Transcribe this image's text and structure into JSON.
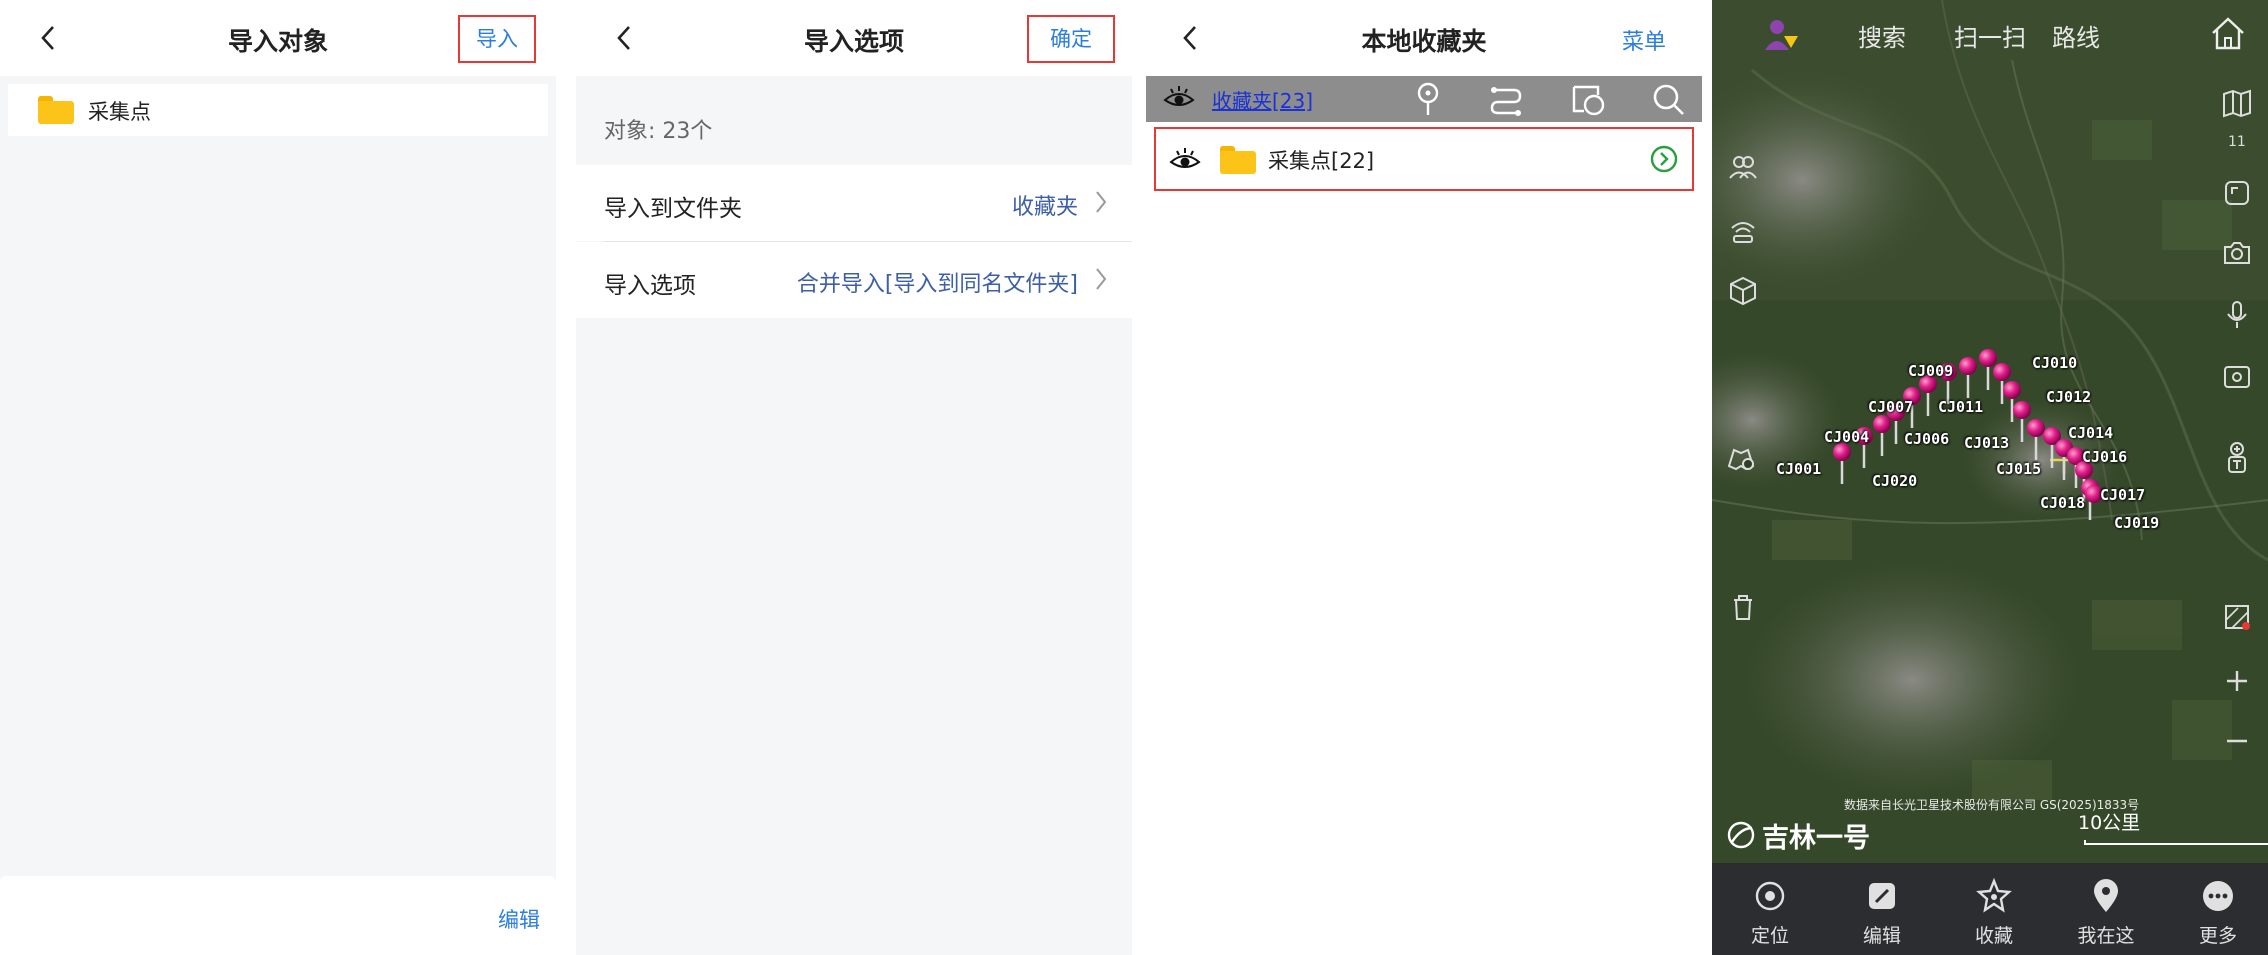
{
  "panel1": {
    "title": "导入对象",
    "action": "导入",
    "row_label": "采集点",
    "bottom_action": "编辑"
  },
  "panel2": {
    "title": "导入选项",
    "action": "确定",
    "count": "对象: 23个",
    "options": [
      {
        "key": "导入到文件夹",
        "value": "收藏夹"
      },
      {
        "key": "导入选项",
        "value": "合并导入[导入到同名文件夹]"
      }
    ]
  },
  "panel3": {
    "title": "本地收藏夹",
    "action": "菜单",
    "toolbar_link": "收藏夹[23]",
    "item_label": "采集点[22]"
  },
  "panel4": {
    "top_nav": [
      "搜索",
      "扫一扫",
      "路线"
    ],
    "zoom_level": "11",
    "points": [
      "CJ001",
      "CJ004",
      "CJ007",
      "CJ009",
      "CJ011",
      "CJ006",
      "CJ020",
      "CJ010",
      "CJ012",
      "CJ013",
      "CJ015",
      "CJ014",
      "CJ016",
      "CJ018",
      "CJ017",
      "CJ019"
    ],
    "credit": "数据来自长光卫星技术股份有限公司 GS(2025)1833号",
    "brand": "吉林一号",
    "scale": "10公里",
    "tabs": [
      "定位",
      "编辑",
      "收藏",
      "我在这",
      "更多"
    ]
  }
}
